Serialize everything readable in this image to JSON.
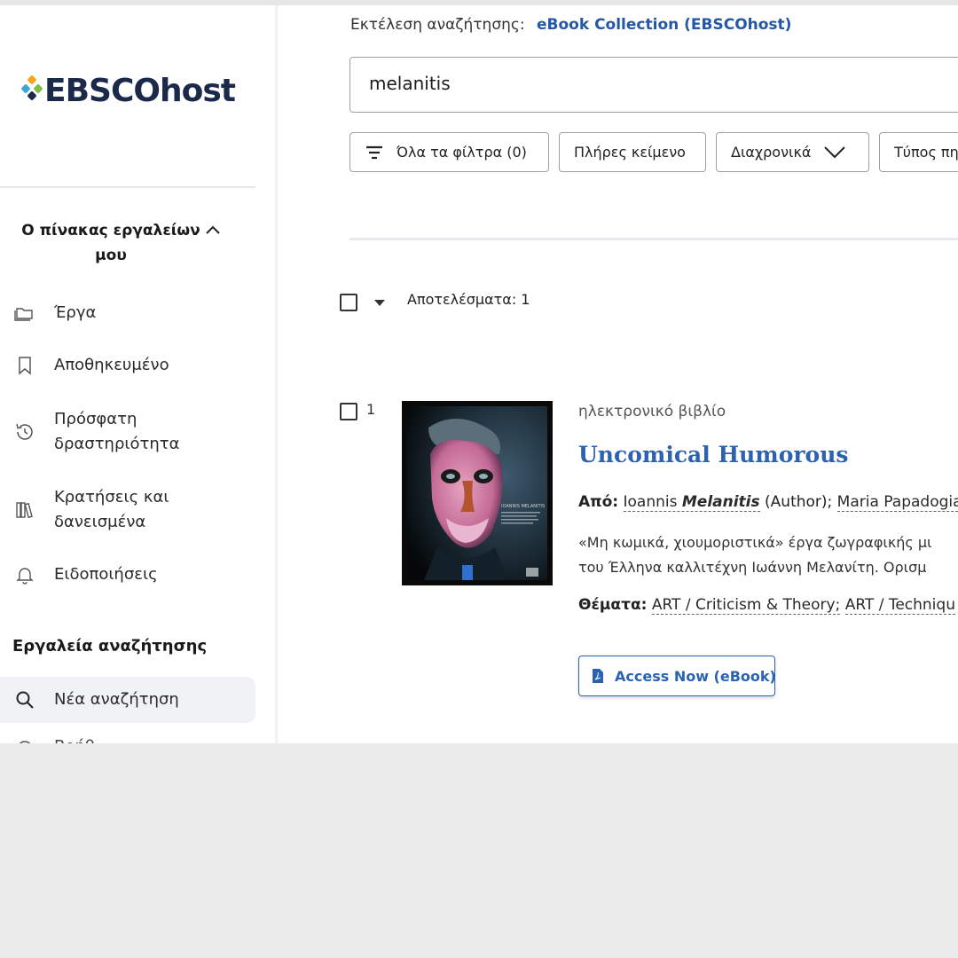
{
  "sidebar": {
    "logo_text": "EBSCOhost",
    "dashboard": {
      "heading": "Ο πίνακας εργαλείων μου",
      "items": [
        {
          "label": "Έργα",
          "icon": "folders-icon"
        },
        {
          "label": "Αποθηκευμένο",
          "icon": "bookmark-icon"
        },
        {
          "label": "Πρόσφατη δραστηριότητα",
          "icon": "history-icon"
        },
        {
          "label": "Κρατήσεις και δανεισμένα",
          "icon": "books-icon"
        },
        {
          "label": "Ειδοποιήσεις",
          "icon": "bell-icon"
        }
      ]
    },
    "search_tools": {
      "heading": "Εργαλεία αναζήτησης",
      "items": [
        {
          "label": "Νέα αναζήτηση",
          "icon": "search-icon",
          "active": true
        },
        {
          "label": "Βοήθ",
          "icon": "help-icon"
        }
      ]
    }
  },
  "main": {
    "search_context_label": "Εκτέλεση αναζήτησης:",
    "search_context_db": "eBook Collection (EBSCOhost)",
    "search_value": "melanitis",
    "filters": [
      {
        "label": "Όλα τα φίλτρα (0)",
        "icon": "filter-icon"
      },
      {
        "label": "Πλήρες κείμενο"
      },
      {
        "label": "Διαχρονικά",
        "icon": "chevron-down-icon"
      },
      {
        "label": "Τύπος πη"
      }
    ],
    "results_label": "Αποτελέσματα: 1",
    "result": {
      "number": "1",
      "type": "ηλεκτρονικό βιβλίο",
      "title": "Uncomical Humorous",
      "by_label": "Από:",
      "author1_first": "Ioannis",
      "author1_last": "Melanitis",
      "author1_role": "(Author);",
      "author2": "Maria Papadogia",
      "abstract_line1": "«Μη κωμικά, χιουμοριστικά» έργα ζωγραφικής μι",
      "abstract_line2": "του Έλληνα καλλιτέχνη Ιωάννη Μελανίτη. Ορισμ",
      "subjects_label": "Θέματα:",
      "subject1": "ART / Criticism & Theory;",
      "subject2": "ART / Techniqu",
      "access_label": "Access Now (eBook)",
      "cover_text": "IOANNIS MELANITIS"
    }
  }
}
